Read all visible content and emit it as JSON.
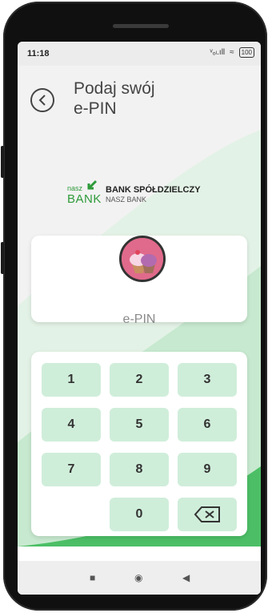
{
  "status_bar": {
    "time": "11:18",
    "signal": "ᵛₒₗ.ıll",
    "wifi": "≈",
    "battery": "100"
  },
  "header": {
    "title_line1": "Podaj swój",
    "title_line2": "e-PIN"
  },
  "logo": {
    "nasz": "nasz",
    "bank": "BANK",
    "name": "BANK SPÓŁDZIELCZY",
    "subname": "NASZ BANK"
  },
  "pin_card": {
    "label": "e-PIN"
  },
  "keypad": {
    "keys": [
      "1",
      "2",
      "3",
      "4",
      "5",
      "6",
      "7",
      "8",
      "9",
      "0"
    ],
    "backspace": "⌫"
  },
  "colors": {
    "accent": "#2e9a3a",
    "key_bg": "#cfeeda",
    "wave_light": "#e3f2e6",
    "wave_dark": "#4cbf66"
  },
  "navbar": {
    "square": "■",
    "circle": "◉",
    "back": "◀"
  }
}
